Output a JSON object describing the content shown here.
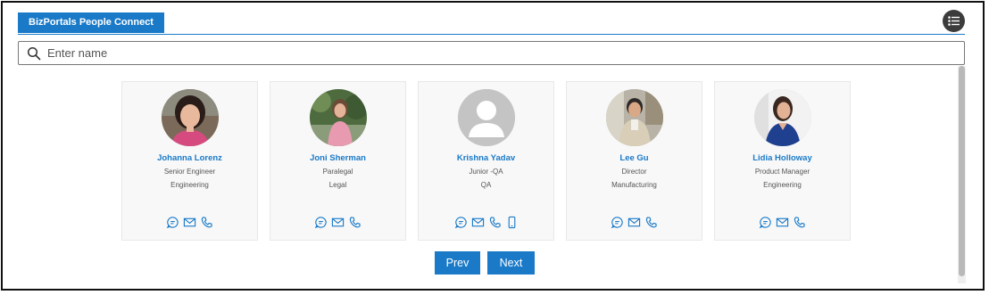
{
  "header": {
    "tab_label": "BizPortals People Connect"
  },
  "search": {
    "placeholder": "Enter name",
    "value": ""
  },
  "accent_color": "#1a7ac8",
  "people": [
    {
      "name": "Johanna Lorenz",
      "title": "Senior Engineer",
      "department": "Engineering",
      "actions": [
        "chat-icon",
        "email-icon",
        "phone-icon"
      ]
    },
    {
      "name": "Joni Sherman",
      "title": "Paralegal",
      "department": "Legal",
      "actions": [
        "chat-icon",
        "email-icon",
        "phone-icon"
      ]
    },
    {
      "name": "Krishna Yadav",
      "title": "Junior -QA",
      "department": "QA",
      "actions": [
        "chat-icon",
        "email-icon",
        "phone-icon",
        "mobile-icon"
      ]
    },
    {
      "name": "Lee Gu",
      "title": "Director",
      "department": "Manufacturing",
      "actions": [
        "chat-icon",
        "email-icon",
        "phone-icon"
      ]
    },
    {
      "name": "Lidia Holloway",
      "title": "Product Manager",
      "department": "Engineering",
      "actions": [
        "chat-icon",
        "email-icon",
        "phone-icon"
      ]
    }
  ],
  "pagination": {
    "prev_label": "Prev",
    "next_label": "Next"
  }
}
